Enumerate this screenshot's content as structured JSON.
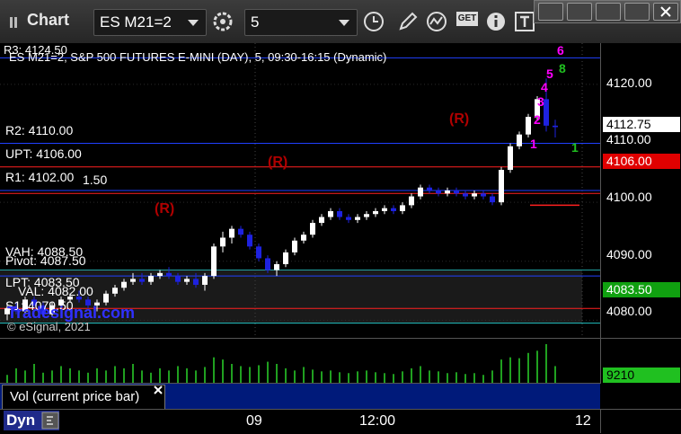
{
  "toolbar": {
    "title": "Chart",
    "symbol": "ES M21=2",
    "interval": "5",
    "icons": [
      "gear-icon",
      "clock-icon",
      "pencil-icon",
      "indicator-icon",
      "get-icon",
      "info-icon",
      "text-tool-icon"
    ],
    "get_label": "GET"
  },
  "window": {
    "buttons": [
      "restore-icon",
      "dock-icon",
      "minimize-icon",
      "maximize-icon",
      "close-icon"
    ]
  },
  "chart": {
    "header": "ES M21=2, S&P 500 FUTURES E-MINI (DAY), 5, 09:30-16:15 (Dynamic)",
    "copyright": "© eSignal, 2021",
    "watermark": "Tradesignal.com",
    "levels": {
      "r3": "R3: 4124.50",
      "r2": "R2: 4110.00",
      "upt": "UPT: 4106.00",
      "r1": "R1: 4102.00",
      "r1_extra": "1.50",
      "vah": "VAH: 4088.50",
      "pivot": "Pivot: 4087.50",
      "lpt": "LPT: 4083.50",
      "val": "VAL: 4082.00",
      "s1": "S1: 4079.50"
    },
    "signals": [
      "(R)",
      "(R)",
      "(R)"
    ],
    "td_counts": [
      "1",
      "2",
      "3",
      "4",
      "5",
      "6",
      "8",
      "1"
    ],
    "colors": {
      "up": "#ffffff",
      "down": "#1e22e0",
      "red": "#ff2020",
      "green": "#20c020",
      "magenta": "#ff00ff"
    }
  },
  "axis": {
    "ticks": [
      "4120.00",
      "4110.00",
      "4100.00",
      "4090.00",
      "4080.00"
    ],
    "last_price": "4112.75",
    "upt_tag": "4106.00",
    "lpt_tag": "4083.50"
  },
  "volume": {
    "label": "Vol (current price bar)",
    "last": "9210"
  },
  "time_axis": {
    "labels": [
      "09",
      "12:00",
      "12"
    ]
  },
  "bottom": {
    "dyn": "Dyn"
  },
  "chart_data": {
    "type": "candlestick",
    "ylim": [
      4077,
      4127
    ],
    "title": "ES M21=2, S&P 500 FUTURES E-MINI (DAY), 5, 09:30-16:15 (Dynamic)",
    "bars": [
      [
        4081,
        4083,
        4080,
        4082
      ],
      [
        4082,
        4083,
        4081,
        4081.5
      ],
      [
        4081.5,
        4084,
        4081,
        4083.5
      ],
      [
        4083.5,
        4084,
        4082,
        4082.5
      ],
      [
        4082.5,
        4083,
        4080.5,
        4081
      ],
      [
        4081,
        4083,
        4080.5,
        4082.5
      ],
      [
        4082.5,
        4084,
        4082,
        4083.5
      ],
      [
        4083.5,
        4084.5,
        4083,
        4084
      ],
      [
        4084,
        4085,
        4083,
        4083.5
      ],
      [
        4083.5,
        4084,
        4082,
        4082.5
      ],
      [
        4082.5,
        4083.5,
        4081.5,
        4083
      ],
      [
        4083,
        4085,
        4082.5,
        4084.5
      ],
      [
        4084.5,
        4086,
        4084,
        4085.5
      ],
      [
        4085.5,
        4087,
        4085,
        4086.5
      ],
      [
        4086.5,
        4088,
        4086,
        4087
      ],
      [
        4087,
        4088,
        4086,
        4086.5
      ],
      [
        4086.5,
        4088,
        4086,
        4087.5
      ],
      [
        4087.5,
        4088.5,
        4087,
        4088
      ],
      [
        4088,
        4089,
        4087,
        4087.5
      ],
      [
        4087.5,
        4088,
        4086,
        4086.5
      ],
      [
        4086.5,
        4087.5,
        4086,
        4087
      ],
      [
        4087,
        4088,
        4085.5,
        4086
      ],
      [
        4086,
        4088,
        4085,
        4087.5
      ],
      [
        4087.5,
        4093,
        4087,
        4092.5
      ],
      [
        4092.5,
        4095,
        4091.5,
        4094
      ],
      [
        4094,
        4096,
        4093,
        4095.5
      ],
      [
        4095.5,
        4096,
        4094,
        4094.5
      ],
      [
        4094.5,
        4095,
        4092,
        4092.5
      ],
      [
        4092.5,
        4093,
        4090,
        4090.5
      ],
      [
        4090.5,
        4091,
        4088,
        4088.5
      ],
      [
        4088.5,
        4090,
        4087.5,
        4089.5
      ],
      [
        4089.5,
        4092,
        4089,
        4091.5
      ],
      [
        4091.5,
        4094,
        4091,
        4093.5
      ],
      [
        4093.5,
        4095,
        4093,
        4094.5
      ],
      [
        4094.5,
        4097,
        4094,
        4096.5
      ],
      [
        4096.5,
        4098,
        4096,
        4097.5
      ],
      [
        4097.5,
        4099,
        4097,
        4098.5
      ],
      [
        4098.5,
        4099,
        4097,
        4097.5
      ],
      [
        4097.5,
        4098,
        4096.5,
        4097
      ],
      [
        4097,
        4098,
        4096.5,
        4097.5
      ],
      [
        4097.5,
        4098.5,
        4097,
        4098
      ],
      [
        4098,
        4099,
        4097.5,
        4098.5
      ],
      [
        4098.5,
        4099.5,
        4098,
        4099
      ],
      [
        4099,
        4099.5,
        4098,
        4098.5
      ],
      [
        4098.5,
        4100,
        4098,
        4099.5
      ],
      [
        4099.5,
        4101.5,
        4099,
        4101
      ],
      [
        4101,
        4103,
        4100.5,
        4102.5
      ],
      [
        4102.5,
        4103,
        4101.5,
        4102
      ],
      [
        4102,
        4102.5,
        4101,
        4101.5
      ],
      [
        4101.5,
        4102.5,
        4101,
        4102
      ],
      [
        4102,
        4102.5,
        4101,
        4101.5
      ],
      [
        4101.5,
        4102,
        4100.5,
        4101
      ],
      [
        4101,
        4102,
        4100.5,
        4101.5
      ],
      [
        4101.5,
        4102,
        4100.5,
        4101
      ],
      [
        4101,
        4101.5,
        4099.5,
        4100
      ],
      [
        4100,
        4106,
        4099.5,
        4105.5
      ],
      [
        4105.5,
        4110,
        4105,
        4109.5
      ],
      [
        4109.5,
        4112,
        4109,
        4111.5
      ],
      [
        4111.5,
        4115,
        4111,
        4114.5
      ],
      [
        4114.5,
        4118,
        4114,
        4117.5
      ],
      [
        4117.5,
        4121,
        4112,
        4113
      ],
      [
        4113,
        4114,
        4111,
        4112.75
      ]
    ],
    "volume": [
      20,
      35,
      30,
      45,
      25,
      30,
      40,
      35,
      30,
      25,
      35,
      30,
      40,
      35,
      45,
      30,
      25,
      35,
      30,
      40,
      35,
      30,
      38,
      60,
      55,
      45,
      40,
      38,
      42,
      50,
      45,
      35,
      30,
      38,
      32,
      28,
      30,
      26,
      24,
      28,
      30,
      26,
      24,
      22,
      28,
      35,
      40,
      30,
      28,
      24,
      26,
      22,
      24,
      20,
      30,
      55,
      60,
      58,
      70,
      75,
      90,
      40
    ]
  }
}
